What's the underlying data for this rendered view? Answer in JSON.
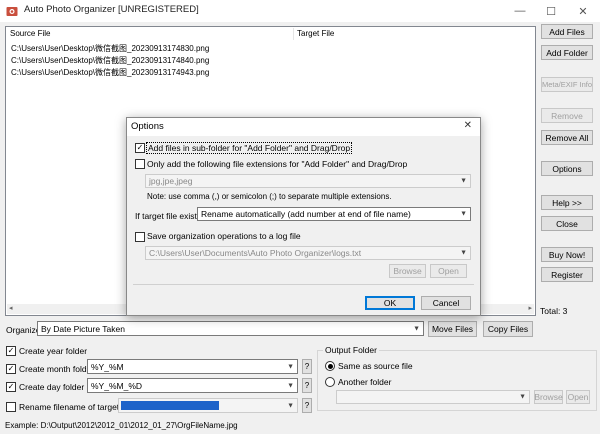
{
  "window": {
    "title": "Auto Photo Organizer [UNREGISTERED]",
    "controls": {
      "minimize": "—",
      "maximize": "☐",
      "close": "✕"
    }
  },
  "filelist": {
    "columns": [
      "Source File",
      "Target File"
    ],
    "rows": [
      "C:\\Users\\User\\Desktop\\微信截图_20230913174830.png",
      "C:\\Users\\User\\Desktop\\微信截图_20230913174840.png",
      "C:\\Users\\User\\Desktop\\微信截图_20230913174943.png"
    ]
  },
  "sidebar": {
    "add_files": "Add Files",
    "add_folder": "Add Folder",
    "meta_exif": "Meta/EXIF Info",
    "remove": "Remove",
    "remove_all": "Remove All",
    "options": "Options",
    "help": "Help >>",
    "close": "Close",
    "buy_now": "Buy Now!",
    "register": "Register",
    "total": "Total: 3"
  },
  "organize": {
    "label": "Organize",
    "value": "By Date Picture Taken",
    "move_files": "Move Files",
    "copy_files": "Copy Files"
  },
  "folders": {
    "create_year": "Create year folder",
    "create_month": "Create month folder",
    "month_value": "%Y_%M",
    "create_day": "Create day folder",
    "day_value": "%Y_%M_%D",
    "rename": "Rename filename of target file",
    "help_q": "?"
  },
  "output": {
    "group_label": "Output Folder",
    "same_as_source": "Same as source file",
    "another": "Another folder",
    "browse": "Browse",
    "open": "Open"
  },
  "example": "Example: D:\\Output\\2012\\2012_01\\2012_01_27\\OrgFileName.jpg",
  "dialog": {
    "title": "Options",
    "close": "✕",
    "add_subfolder": "Add files in sub-folder for \"Add Folder\" and Drag/Drop",
    "only_ext": "Only add the following file extensions for \"Add Folder\" and Drag/Drop",
    "ext_value": "jpg,jpe,jpeg",
    "note": "Note: use comma (,) or semicolon (;) to separate multiple extensions.",
    "if_exists_label": "If target file exists",
    "if_exists_value": "Rename automatically (add number at end of file name)",
    "save_log": "Save organization operations to a log file",
    "log_path": "C:\\Users\\User\\Documents\\Auto Photo Organizer\\logs.txt",
    "browse": "Browse",
    "open": "Open",
    "ok": "OK",
    "cancel": "Cancel"
  }
}
